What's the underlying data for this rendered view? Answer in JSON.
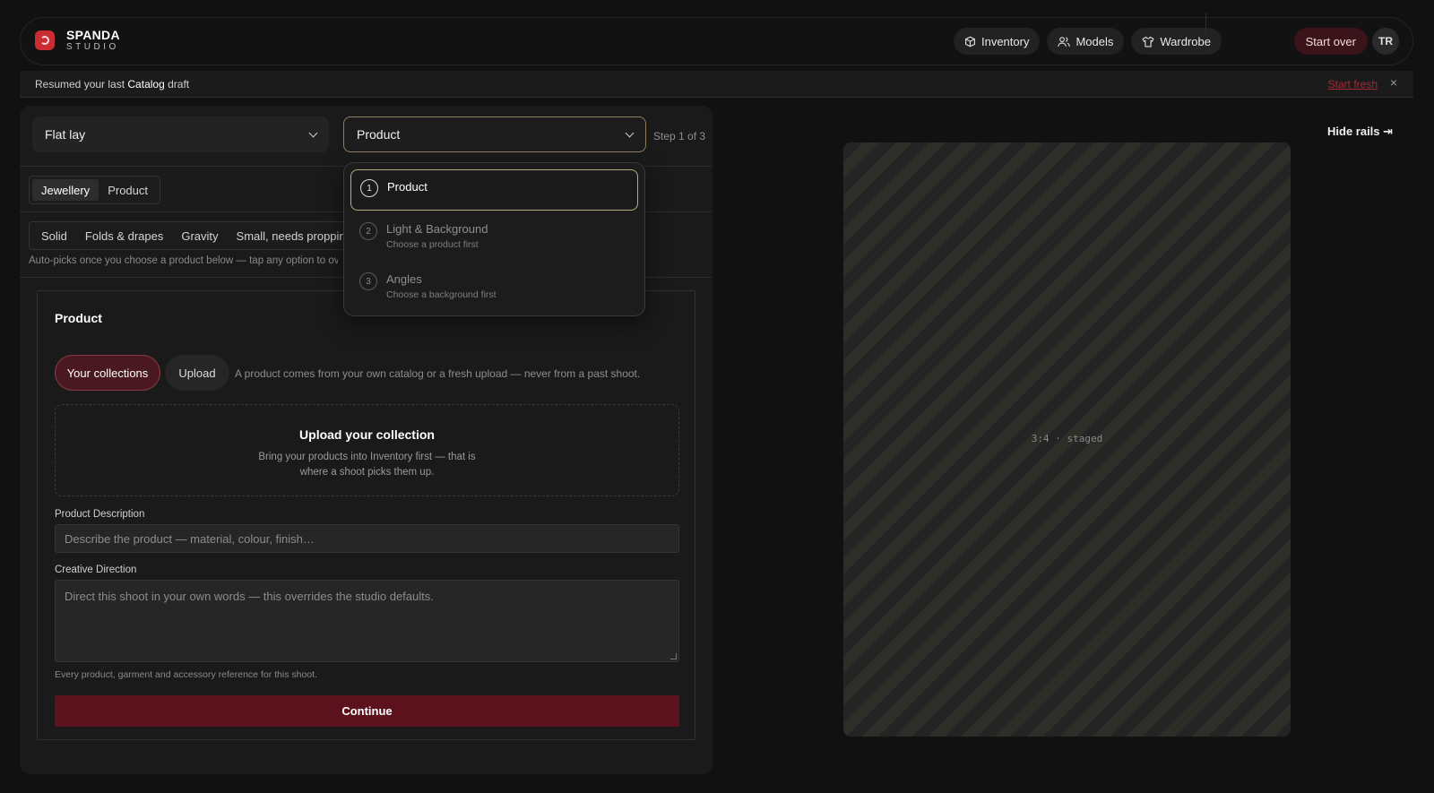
{
  "brand": {
    "name": "SPANDA",
    "sub": "STUDIO"
  },
  "nav": {
    "inventory": "Inventory",
    "models": "Models",
    "wardrobe": "Wardrobe"
  },
  "header": {
    "start_over": "Start over",
    "avatar": "TR"
  },
  "banner": {
    "prefix": "Resumed your last ",
    "highlight": "Catalog",
    "suffix": " draft",
    "start_fresh": "Start fresh",
    "close": "×"
  },
  "selects": {
    "shot_type": "Flat lay",
    "step": "Product",
    "step_counter": "Step 1 of 3"
  },
  "category_tabs": [
    "Jewellery",
    "Product"
  ],
  "handling_options": [
    "Solid",
    "Folds & drapes",
    "Gravity",
    "Small, needs propping"
  ],
  "handling_hint": "Auto-picks once you choose a product below — tap any option to override",
  "product_card": {
    "title": "Product",
    "tab_collections": "Your collections",
    "tab_upload": "Upload",
    "tab_hint": "A product comes from your own catalog or a fresh upload — never from a past shoot.",
    "dropzone_title": "Upload your collection",
    "dropzone_body": "Bring your products into Inventory first — that is where a shoot picks them up.",
    "description_label": "Product Description",
    "description_placeholder": "Describe the product — material, colour, finish…",
    "direction_label": "Creative Direction",
    "direction_placeholder": "Direct this shoot in your own words — this overrides the studio defaults.",
    "footer_hint": "Every product, garment and accessory reference for this shoot.",
    "continue": "Continue"
  },
  "step_menu": [
    {
      "num": "1",
      "title": "Product",
      "sub": ""
    },
    {
      "num": "2",
      "title": "Light & Background",
      "sub": "Choose a product first"
    },
    {
      "num": "3",
      "title": "Angles",
      "sub": "Choose a background first"
    }
  ],
  "right": {
    "hide_rails": "Hide rails ⇥",
    "canvas_label": "3:4 · staged"
  },
  "colors": {
    "accent": "#5c121c",
    "brand_red": "#c92c33",
    "selected_outline": "#b9ac83"
  }
}
